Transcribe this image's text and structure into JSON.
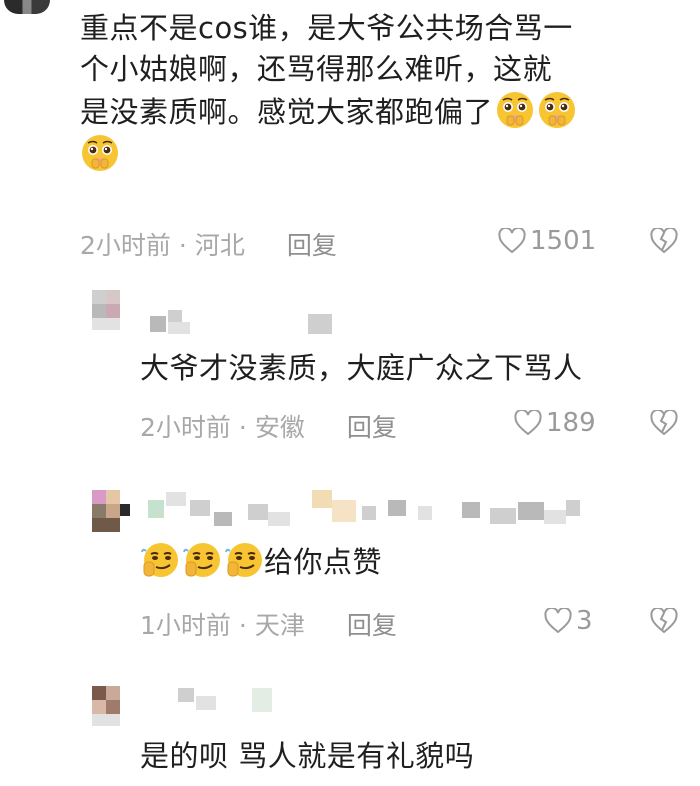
{
  "comments": [
    {
      "text_line1": "重点不是cos谁，是大爷公共场合骂一",
      "text_line2": "个小姑娘啊，还骂得那么难听，这就",
      "text_line3": "是没素质啊。感觉大家都跑偏了",
      "time": "2小时前",
      "location": "河北",
      "reply_label": "回复",
      "likes": "1501"
    },
    {
      "text": "大爷才没素质，大庭广众之下骂人",
      "time": "2小时前",
      "location": "安徽",
      "reply_label": "回复",
      "likes": "189"
    },
    {
      "text": "给你点赞",
      "time": "1小时前",
      "location": "天津",
      "reply_label": "回复",
      "likes": "3"
    },
    {
      "text": "是的呗 骂人就是有礼貌吗"
    }
  ],
  "meta_separator": "·",
  "icons": {
    "like": "heart-outline-icon",
    "dislike": "broken-heart-icon",
    "emoji_pleading": "pleading-face-emoji",
    "emoji_smirk": "smirk-salute-emoji"
  },
  "colors": {
    "text": "#1f1f1f",
    "meta": "#a8a8a8",
    "emoji_yellow": "#f7c531"
  }
}
